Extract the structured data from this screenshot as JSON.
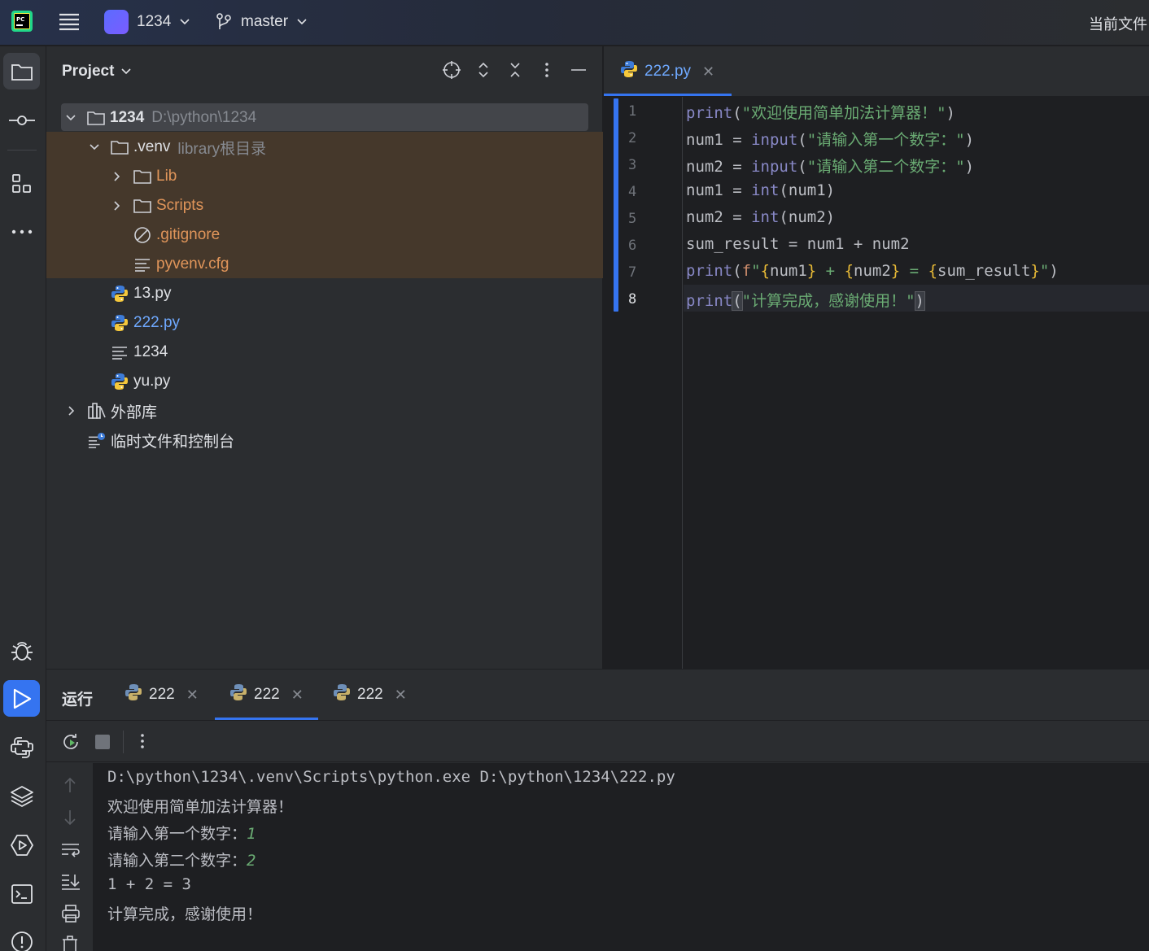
{
  "titlebar": {
    "project_name": "1234",
    "branch": "master",
    "right_text": "当前文件"
  },
  "project_panel": {
    "title": "Project",
    "root": {
      "name": "1234",
      "path": "D:\\python\\1234"
    },
    "venv": {
      "name": ".venv",
      "note": "library根目录"
    },
    "items": [
      {
        "label": "Lib"
      },
      {
        "label": "Scripts"
      },
      {
        "label": ".gitignore"
      },
      {
        "label": "pyvenv.cfg"
      },
      {
        "label": "13.py"
      },
      {
        "label": "222.py"
      },
      {
        "label": "1234"
      },
      {
        "label": "yu.py"
      },
      {
        "label": "外部库"
      },
      {
        "label": "临时文件和控制台"
      }
    ]
  },
  "editor": {
    "tab_label": "222.py",
    "line_numbers": [
      "1",
      "2",
      "3",
      "4",
      "5",
      "6",
      "7",
      "8"
    ],
    "current_line": "8",
    "code": {
      "l1_fn": "print",
      "l1_str": "\"欢迎使用简单加法计算器！\"",
      "l2_var": "num1",
      "l2_fn": "input",
      "l2_str": "\"请输入第一个数字：\"",
      "l3_var": "num2",
      "l3_fn": "input",
      "l3_str": "\"请输入第二个数字：\"",
      "l4_var": "num1",
      "l4_fn": "int",
      "l4_arg": "num1",
      "l5_var": "num2",
      "l5_fn": "int",
      "l5_arg": "num2",
      "l6": "sum_result = num1 + num2",
      "l7_fn": "print",
      "l7_a": "num1",
      "l7_b": "num2",
      "l7_c": "sum_result",
      "l8_fn": "print",
      "l8_str": "\"计算完成，感谢使用！\""
    }
  },
  "run_panel": {
    "title": "运行",
    "tabs": [
      {
        "label": "222"
      },
      {
        "label": "222"
      },
      {
        "label": "222"
      }
    ],
    "console": {
      "cmd": "D:\\python\\1234\\.venv\\Scripts\\python.exe D:\\python\\1234\\222.py",
      "welcome": "欢迎使用简单加法计算器！",
      "prompt1": "请输入第一个数字：",
      "input1": "1",
      "prompt2": "请输入第二个数字：",
      "input2": "2",
      "result": "1 + 2 = 3",
      "done": "计算完成，感谢使用！"
    }
  },
  "colors": {
    "accent": "#3574f0",
    "background": "#1e1f22",
    "panel": "#2b2d30",
    "excluded_folder": "#e0955a",
    "string": "#6aab73"
  }
}
